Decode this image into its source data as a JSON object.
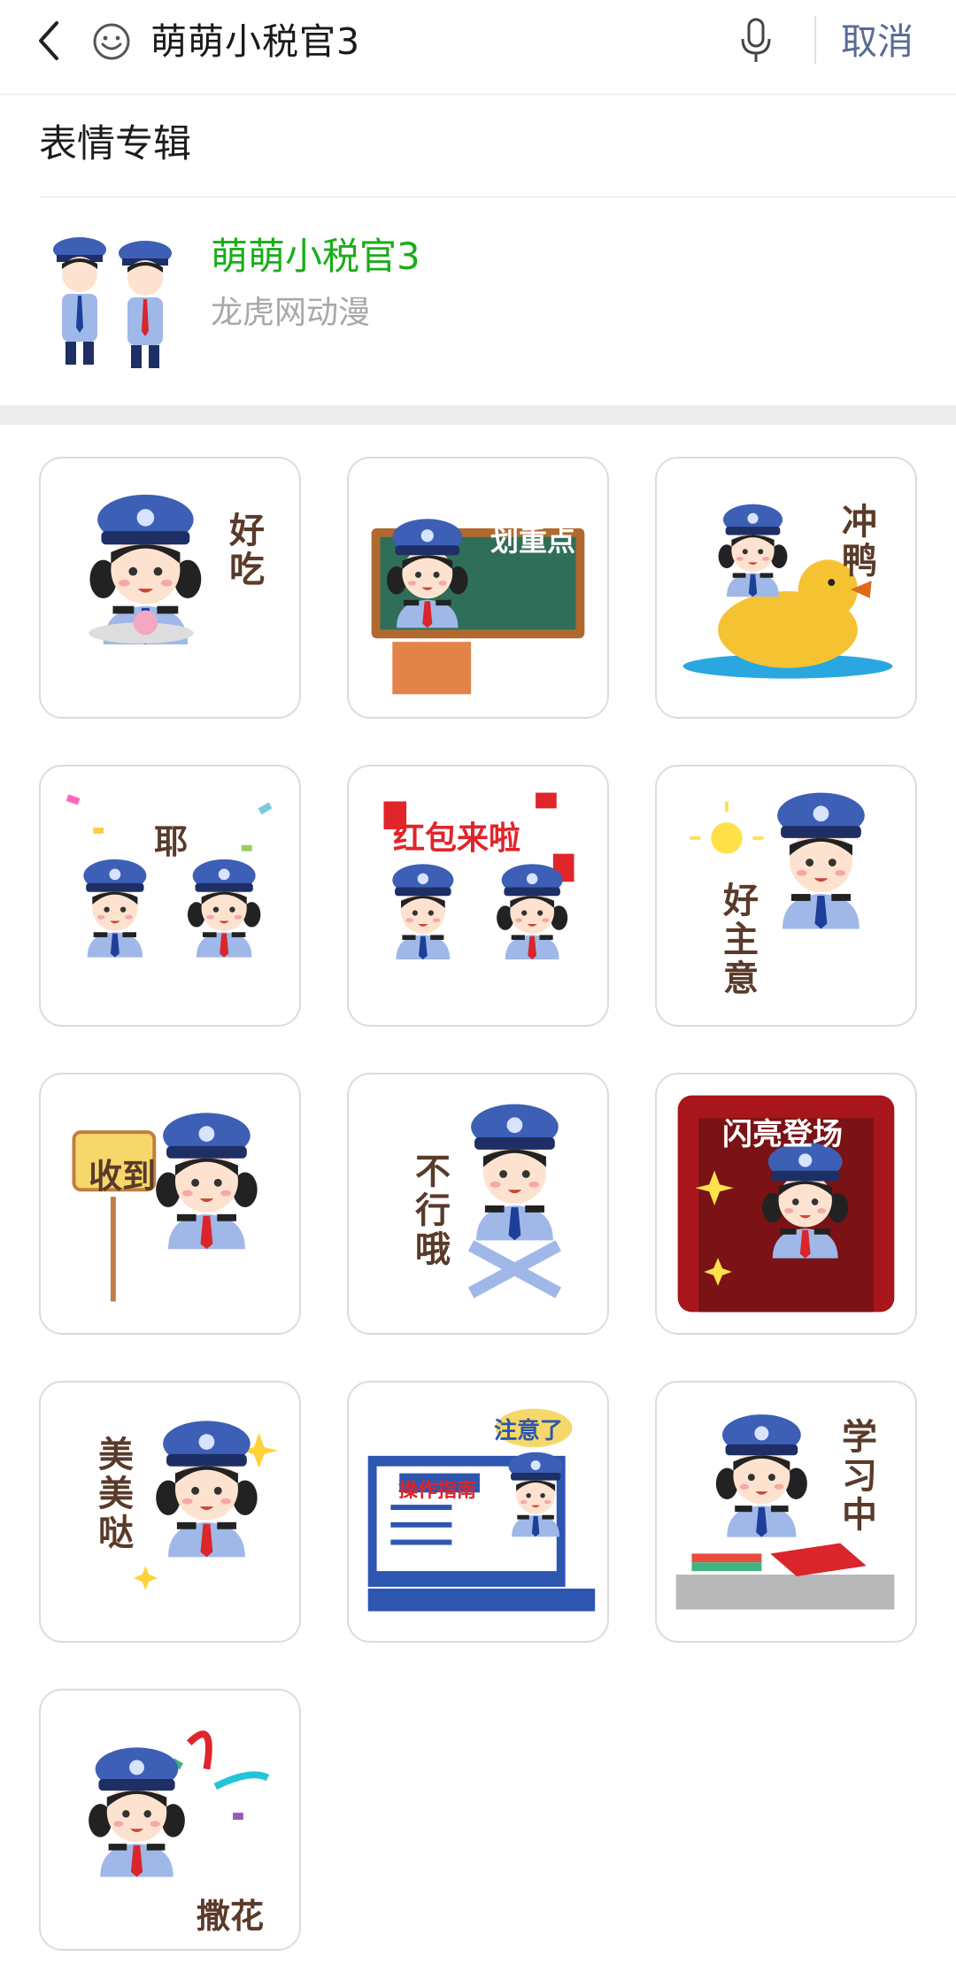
{
  "header": {
    "search_query": "萌萌小税官3",
    "cancel_label": "取消",
    "icons": [
      "chevron-left-icon",
      "emoji-icon",
      "microphone-icon"
    ]
  },
  "section": {
    "title": "表情专辑"
  },
  "album": {
    "name": "萌萌小税官3",
    "author": "龙虎网动漫",
    "name_color": "#1aad19"
  },
  "stickers": [
    {
      "caption": "好吃"
    },
    {
      "caption": "划重点"
    },
    {
      "caption": "冲鸭"
    },
    {
      "caption": "耶"
    },
    {
      "caption": "红包来啦"
    },
    {
      "caption": "好主意"
    },
    {
      "caption": "收到"
    },
    {
      "caption": "不行哦"
    },
    {
      "caption": "闪亮登场"
    },
    {
      "caption": "美美哒"
    },
    {
      "caption": "操作指南"
    },
    {
      "caption": "注意了"
    },
    {
      "caption": "学习中"
    },
    {
      "caption": "撒花"
    }
  ],
  "colors": {
    "accent": "#576b95",
    "uniform_blue": "#3d5fb5",
    "tie_red": "#d9252b"
  }
}
